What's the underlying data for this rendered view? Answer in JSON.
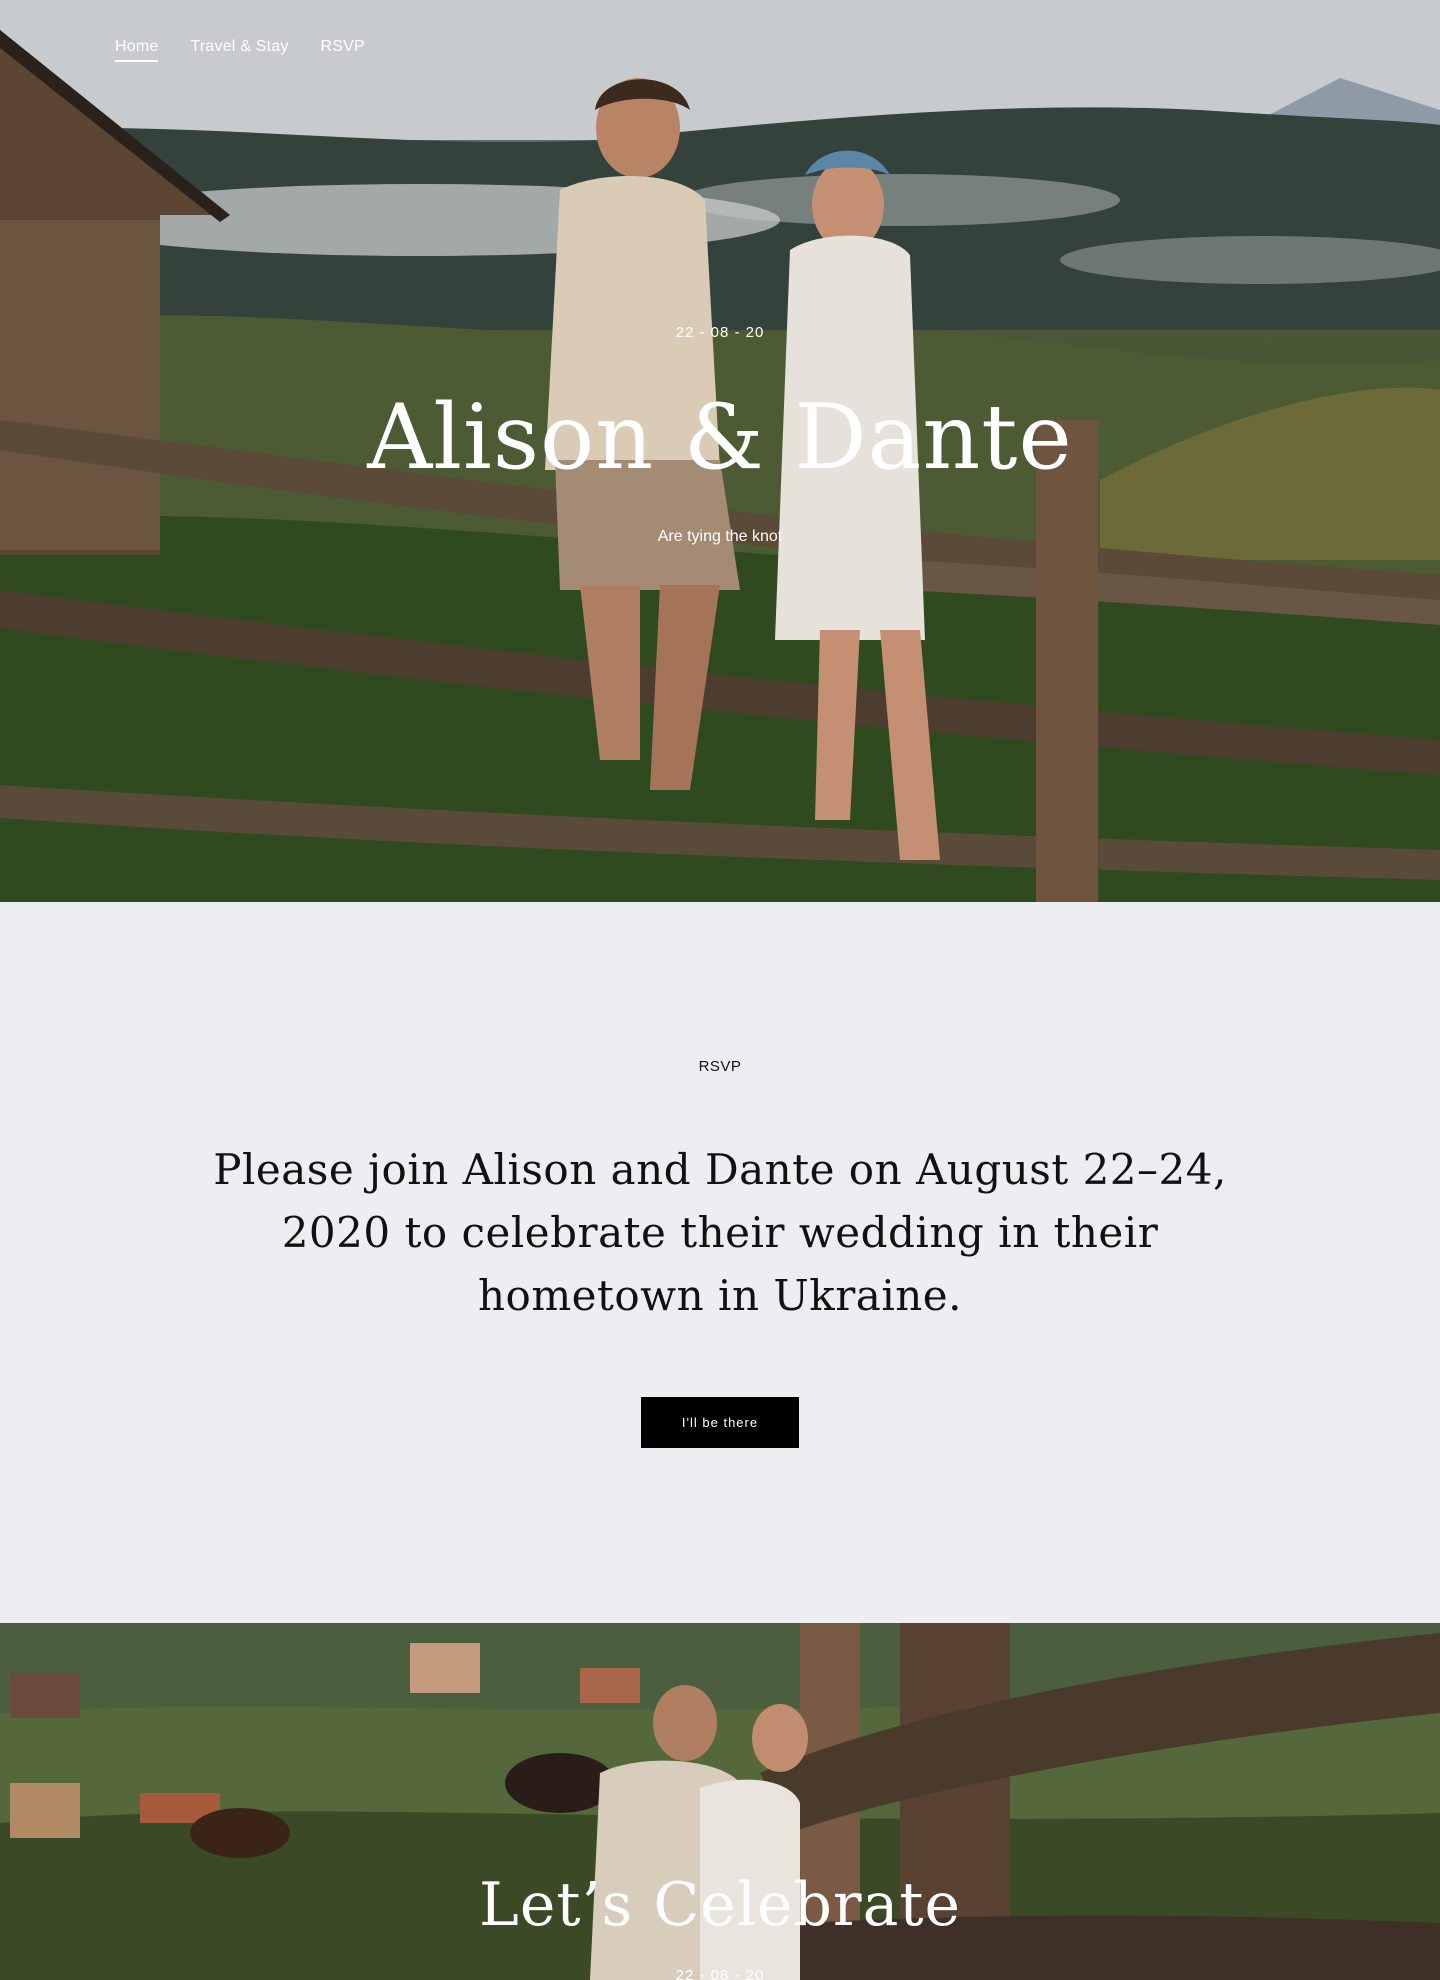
{
  "nav": {
    "items": [
      {
        "label": "Home",
        "active": true
      },
      {
        "label": "Travel & Stay",
        "active": false
      },
      {
        "label": "RSVP",
        "active": false
      }
    ]
  },
  "hero": {
    "date": "22 - 08 - 20",
    "title": "Alison & Dante",
    "subtitle": "Are tying the knot"
  },
  "rsvp": {
    "label": "RSVP",
    "text": "Please join Alison and Dante on August 22–24, 2020 to celebrate their wedding in their hometown in Ukraine.",
    "button_label": "I'll be there"
  },
  "celebrate": {
    "title": "Let’s Celebrate",
    "date": "22 - 08 - 20"
  },
  "colors": {
    "page_background": "#ECEEF1",
    "button_background": "#000000",
    "hero_text": "#FFFFFF"
  }
}
